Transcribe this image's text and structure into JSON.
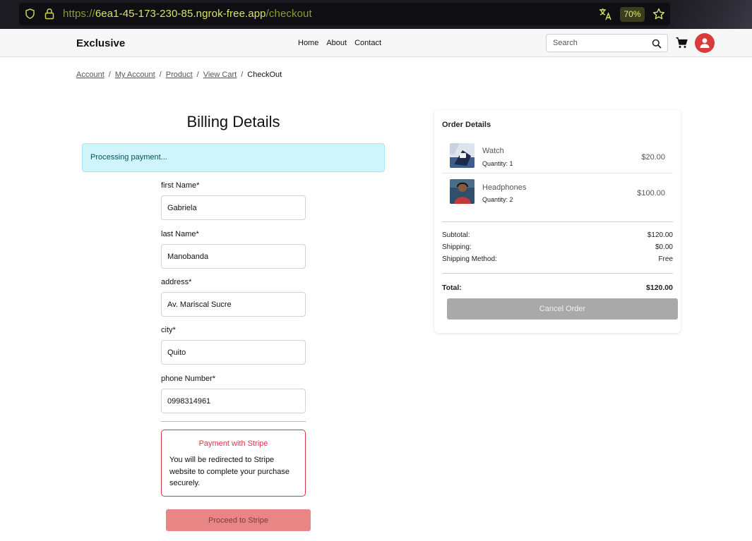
{
  "browser": {
    "url_protocol": "https://",
    "url_host": "6ea1-45-173-230-85.ngrok-free.app",
    "url_path": "/checkout",
    "zoom": "70%"
  },
  "header": {
    "brand": "Exclusive",
    "nav": [
      "Home",
      "About",
      "Contact"
    ],
    "search_placeholder": "Search"
  },
  "breadcrumb": {
    "links": [
      "Account",
      "My Account",
      "Product",
      "View Cart"
    ],
    "current": "CheckOut",
    "separator": "/"
  },
  "billing": {
    "title": "Billing Details",
    "alert": "Processing payment...",
    "fields": [
      {
        "label": "first Name*",
        "value": "Gabriela"
      },
      {
        "label": "last Name*",
        "value": "Manobanda"
      },
      {
        "label": "address*",
        "value": "Av. Mariscal Sucre"
      },
      {
        "label": "city*",
        "value": "Quito"
      },
      {
        "label": "phone Number*",
        "value": "0998314961"
      }
    ],
    "stripe": {
      "title": "Payment with Stripe",
      "text": "You will be redirected to Stripe website to complete your purchase securely.",
      "button": "Proceed to Stripe"
    }
  },
  "order": {
    "title": "Order Details",
    "items": [
      {
        "name": "Watch",
        "quantity": "Quantity: 1",
        "price": "$20.00"
      },
      {
        "name": "Headphones",
        "quantity": "Quantity: 2",
        "price": "$100.00"
      }
    ],
    "summary": {
      "subtotal_label": "Subtotal:",
      "subtotal": "$120.00",
      "shipping_label": "Shipping:",
      "shipping": "$0.00",
      "method_label": "Shipping Method:",
      "method": "Free",
      "total_label": "Total:",
      "total": "$120.00"
    },
    "cancel_button": "Cancel Order"
  },
  "colors": {
    "accent_red": "#dc3545",
    "alert_bg": "#cff4fc",
    "stripe_button": "#ea8585",
    "cancel_button": "#a9a9a9",
    "avatar": "#d93a3a"
  }
}
